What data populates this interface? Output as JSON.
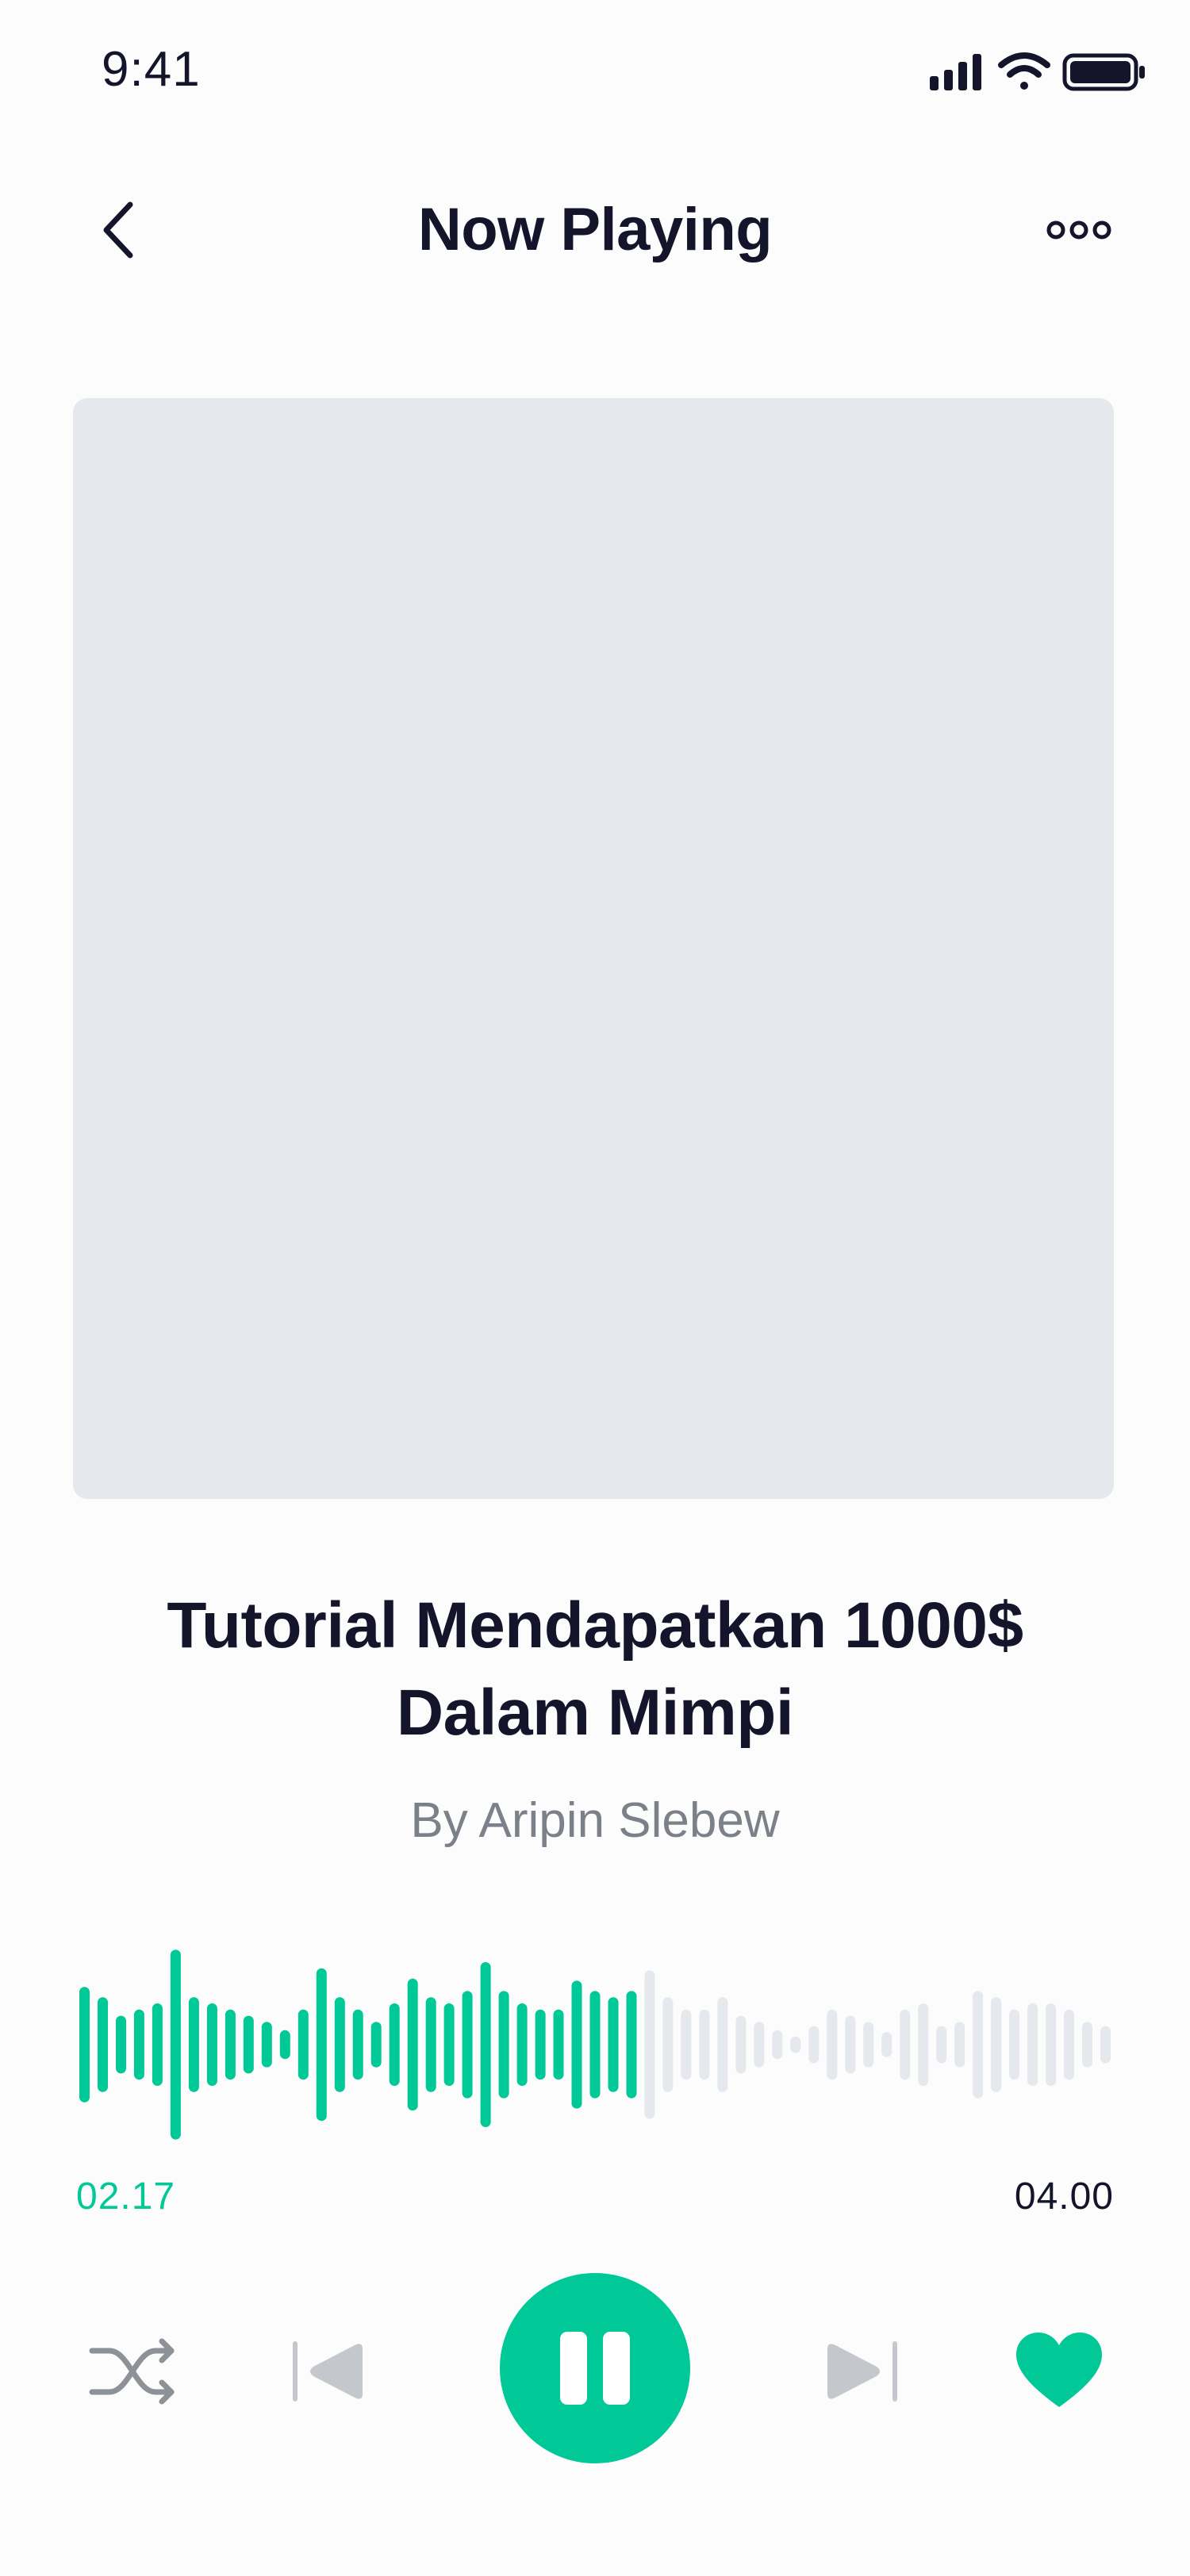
{
  "status_bar": {
    "time": "9:41",
    "icons": [
      "cellular-signal-icon",
      "wifi-icon",
      "battery-icon"
    ]
  },
  "header": {
    "title": "Now Playing",
    "back_icon": "chevron-left-icon",
    "more_icon": "more-horizontal-icon"
  },
  "track": {
    "title": "Tutorial Mendapatkan 1000$ Dalam Mimpi",
    "artist": "By Aripin Slebew"
  },
  "playback": {
    "elapsed": "02.17",
    "total": "04.00",
    "progress": 0.5425,
    "waveform_levels": [
      0.56,
      0.46,
      0.28,
      0.34,
      0.4,
      0.92,
      0.46,
      0.4,
      0.34,
      0.28,
      0.22,
      0.14,
      0.34,
      0.74,
      0.46,
      0.34,
      0.22,
      0.4,
      0.64,
      0.46,
      0.4,
      0.52,
      0.8,
      0.52,
      0.4,
      0.34,
      0.34,
      0.62,
      0.52,
      0.46,
      0.52,
      0.72,
      0.46,
      0.34,
      0.34,
      0.46,
      0.28,
      0.22,
      0.14,
      0.08,
      0.18,
      0.34,
      0.28,
      0.22,
      0.12,
      0.34,
      0.4,
      0.18,
      0.22,
      0.52,
      0.46,
      0.34,
      0.4,
      0.4,
      0.34,
      0.22,
      0.18
    ]
  },
  "controls": {
    "shuffle_icon": "shuffle-icon",
    "previous_icon": "skip-previous-icon",
    "play_pause_icon": "pause-icon",
    "next_icon": "skip-next-icon",
    "like_icon": "heart-icon",
    "liked": true
  },
  "colors": {
    "accent": "#00c896",
    "inactive_wave": "#e5e9ed",
    "text_primary": "#14142b",
    "text_secondary": "#7c8088",
    "icon_muted": "#c4c8cd"
  }
}
